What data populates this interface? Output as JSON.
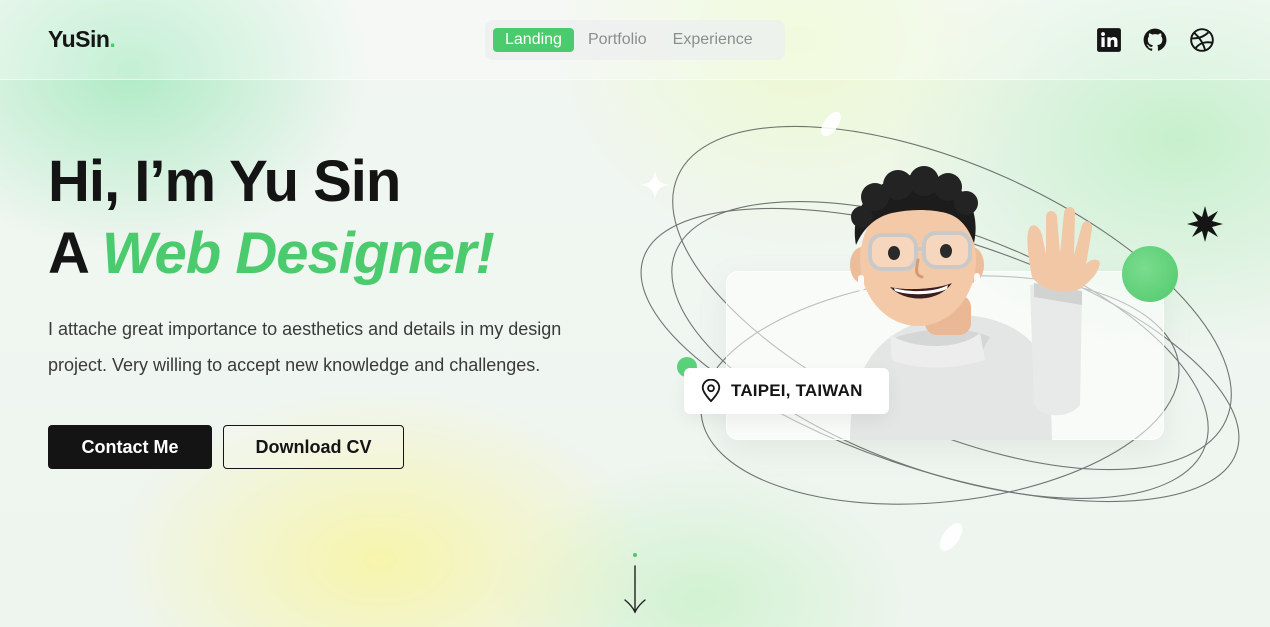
{
  "header": {
    "logo_text": "YuSin",
    "logo_dot": ".",
    "nav": [
      {
        "label": "Landing",
        "active": true
      },
      {
        "label": "Portfolio",
        "active": false
      },
      {
        "label": "Experience",
        "active": false
      }
    ],
    "social_icons": [
      "linkedin-icon",
      "github-icon",
      "dribbble-icon"
    ]
  },
  "hero": {
    "greeting": "Hi, I’m Yu Sin",
    "line2_prefix": "A ",
    "line2_accent": "Web Designer!",
    "description": "I attache great importance to aesthetics and details in my design project. Very willing to accept new knowledge and challenges.",
    "contact_label": "Contact Me",
    "cv_label": "Download CV"
  },
  "illustration": {
    "location": "TAIPEI, TAIWAN",
    "location_icon": "map-pin-icon",
    "avatar_icon": "memoji-avatar"
  },
  "colors": {
    "accent": "#4ccb6e",
    "dark": "#141414"
  }
}
